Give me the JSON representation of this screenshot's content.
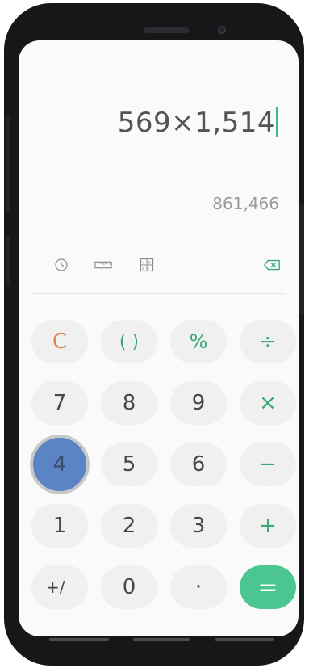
{
  "display": {
    "expression": "569×1,514",
    "result": "861,466"
  },
  "toolbar": {
    "history_icon": "history-clock-icon",
    "converter_icon": "ruler-icon",
    "scientific_icon": "scientific-mode-icon",
    "backspace_icon": "backspace-icon"
  },
  "keys": {
    "clear": "C",
    "parentheses": "( )",
    "percent": "%",
    "divide": "÷",
    "seven": "7",
    "eight": "8",
    "nine": "9",
    "multiply": "×",
    "four": "4",
    "five": "5",
    "six": "6",
    "minus": "−",
    "one": "1",
    "two": "2",
    "three": "3",
    "plus": "+",
    "plus_minus": "+/₋",
    "zero": "0",
    "decimal": "·",
    "equals": "="
  },
  "colors": {
    "accent_green": "#3aa877",
    "equals_bg": "#4cc690",
    "clear_orange": "#e0844e",
    "pressed_key": "#5b84c4"
  }
}
